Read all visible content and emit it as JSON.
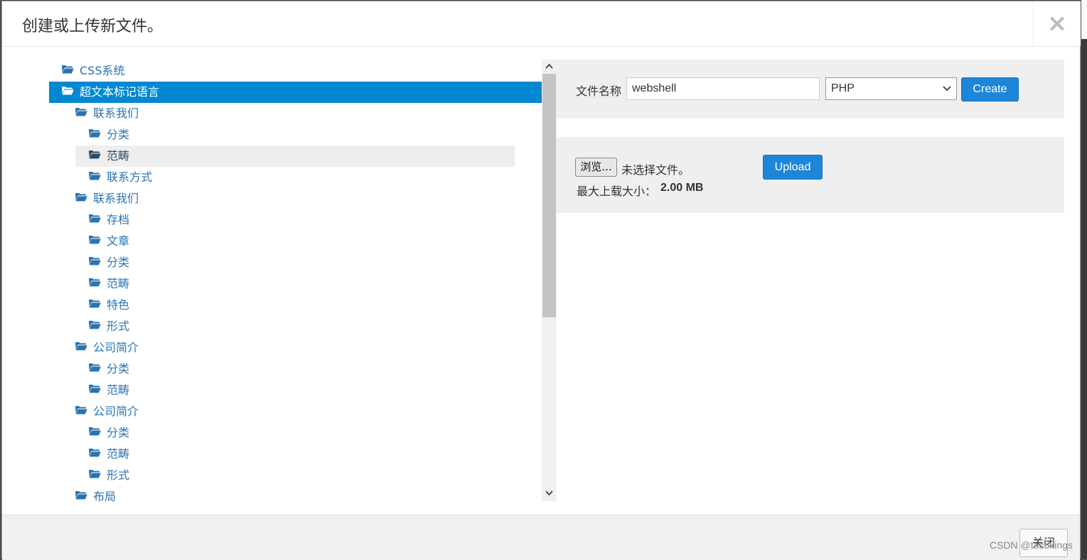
{
  "dialog": {
    "title": "创建或上传新文件。",
    "close_symbol": "×"
  },
  "tree": [
    {
      "label": "CSS系统",
      "level": 0
    },
    {
      "label": "超文本标记语言",
      "level": 0,
      "selected": true
    },
    {
      "label": "联系我们",
      "level": 1
    },
    {
      "label": "分类",
      "level": 2
    },
    {
      "label": "范畴",
      "level": 2,
      "hover": true
    },
    {
      "label": "联系方式",
      "level": 2
    },
    {
      "label": "联系我们",
      "level": 1
    },
    {
      "label": "存档",
      "level": 2
    },
    {
      "label": "文章",
      "level": 2
    },
    {
      "label": "分类",
      "level": 2
    },
    {
      "label": "范畴",
      "level": 2
    },
    {
      "label": "特色",
      "level": 2
    },
    {
      "label": "形式",
      "level": 2
    },
    {
      "label": "公司简介",
      "level": 1
    },
    {
      "label": "分类",
      "level": 2
    },
    {
      "label": "范畴",
      "level": 2
    },
    {
      "label": "公司简介",
      "level": 1
    },
    {
      "label": "分类",
      "level": 2
    },
    {
      "label": "范畴",
      "level": 2
    },
    {
      "label": "形式",
      "level": 2
    },
    {
      "label": "布局",
      "level": 1
    }
  ],
  "create": {
    "label": "文件名称",
    "filename_value": "webshell",
    "type_selected": "PHP",
    "button_label": "Create"
  },
  "upload": {
    "browse_label": "浏览...",
    "no_file_text": "未选择文件。",
    "button_label": "Upload",
    "max_size_label": "最大上载大小：",
    "max_size_value": "2.00 MB"
  },
  "footer": {
    "close_label": "关闭"
  },
  "watermark": "CSDN @tacokings",
  "colors": {
    "selected_bg": "#0288d1",
    "link": "#2a73b0",
    "primary_button": "#1e86d8"
  }
}
